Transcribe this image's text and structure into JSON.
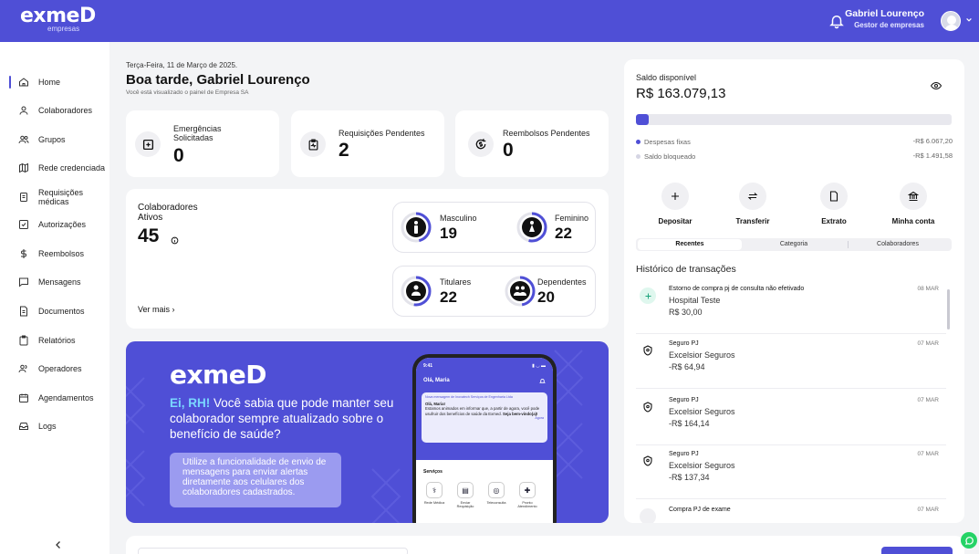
{
  "header": {
    "brand": "exmeD",
    "brand_sub": "empresas",
    "user_name": "Gabriel Lourenço",
    "user_role": "Gestor de empresas"
  },
  "sidebar": {
    "items": [
      {
        "label": "Home",
        "icon": "home-icon"
      },
      {
        "label": "Colaboradores",
        "icon": "user-icon"
      },
      {
        "label": "Grupos",
        "icon": "users-icon"
      },
      {
        "label": "Rede credenciada",
        "icon": "map-icon"
      },
      {
        "label": "Requisições médicas",
        "icon": "clipboard-icon"
      },
      {
        "label": "Autorizações",
        "icon": "check-square-icon"
      },
      {
        "label": "Reembolsos",
        "icon": "dollar-icon"
      },
      {
        "label": "Mensagens",
        "icon": "message-icon"
      },
      {
        "label": "Documentos",
        "icon": "document-icon"
      },
      {
        "label": "Relatórios",
        "icon": "report-icon"
      },
      {
        "label": "Operadores",
        "icon": "operators-icon"
      },
      {
        "label": "Agendamentos",
        "icon": "calendar-icon"
      },
      {
        "label": "Logs",
        "icon": "logs-icon"
      }
    ]
  },
  "greeting": {
    "date": "Terça-Feira, 11 de Março de 2025.",
    "title": "Boa tarde, Gabriel Lourenço",
    "subtitle": "Você está visualizado o painel de Empresa SA"
  },
  "stats": {
    "emergencias_label": "Emergências Solicitadas",
    "emergencias_value": "0",
    "requisicoes_label": "Requisições Pendentes",
    "requisicoes_value": "2",
    "reembolsos_label": "Reembolsos Pendentes",
    "reembolsos_value": "0"
  },
  "colaboradores": {
    "title": "Colaboradores Ativos",
    "total": "45",
    "ver_mais": "Ver mais",
    "masculino_label": "Masculino",
    "masculino_value": "19",
    "feminino_label": "Feminino",
    "feminino_value": "22",
    "titulares_label": "Titulares",
    "titulares_value": "22",
    "dependentes_label": "Dependentes",
    "dependentes_value": "20"
  },
  "banner": {
    "logo": "exmeD",
    "headline_highlight": "Ei, RH!",
    "headline_rest": " Você sabia que pode manter seu colaborador sempre atualizado sobre o benefício de saúde?",
    "box_text": "Utilize a funcionalidade de envio de mensagens para enviar alertas diretamente aos celulares dos colaboradores cadastrados.",
    "phone_time": "9:41",
    "phone_greeting": "Olá, Maria",
    "msg_header": "Nova mensagem de Inovatech Serviços de Engenharia Ltda",
    "msg_hello": "Olá, Maria!",
    "msg_body": "Estamos animados em informar que, a partir de agora, você pode usufruir dos benefícios de saúde da Exmed.",
    "msg_bold": "Seja bem-vindo(a)!",
    "msg_time": "Agora",
    "services_title": "Serviços",
    "services": [
      "Rede Médica",
      "Enviar Requisição",
      "Teleconsulta",
      "Pronto Atendimento"
    ]
  },
  "saldo": {
    "label": "Saldo disponível",
    "value": "R$ 163.079,13",
    "progress_fraction": 0.04,
    "despesas_label": "Despesas fixas",
    "despesas_value": "-R$ 6.067,20",
    "bloqueado_label": "Saldo bloqueado",
    "bloqueado_value": "-R$ 1.491,58",
    "actions": [
      "Depositar",
      "Transferir",
      "Extrato",
      "Minha conta"
    ],
    "tabs": [
      "Recentes",
      "Categoria",
      "Colaboradores"
    ],
    "history_title": "Histórico de transações",
    "transactions": [
      {
        "title": "Estorno de compra pj de consulta não efetivado",
        "name": "Hospital Teste",
        "amount": "R$ 30,00",
        "date": "08 MAR"
      },
      {
        "title": "Seguro PJ",
        "name": "Excelsior Seguros",
        "amount": "-R$ 64,94",
        "date": "07 MAR"
      },
      {
        "title": "Seguro PJ",
        "name": "Excelsior Seguros",
        "amount": "-R$ 164,14",
        "date": "07 MAR"
      },
      {
        "title": "Seguro PJ",
        "name": "Excelsior Seguros",
        "amount": "-R$ 137,34",
        "date": "07 MAR"
      },
      {
        "title": "Compra PJ de exame",
        "name": "",
        "amount": "",
        "date": "07 MAR"
      }
    ]
  },
  "colors": {
    "primary": "#4f4fd6",
    "accent_cyan": "#7ad7ff",
    "whatsapp": "#25d366"
  }
}
